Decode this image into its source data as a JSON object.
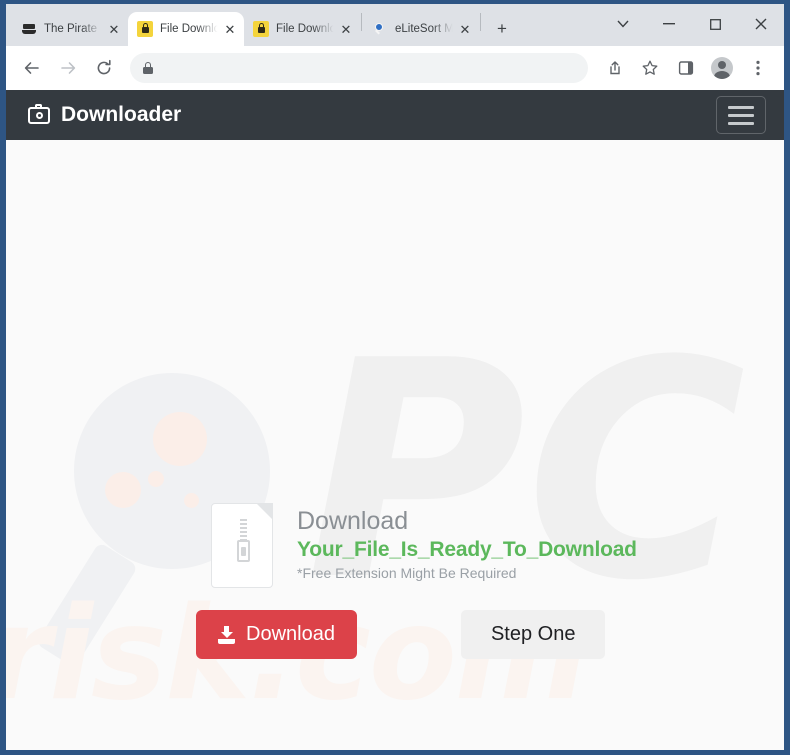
{
  "browser": {
    "tabs": [
      {
        "title": "The Pirate ",
        "favicon": "pirate-ship-icon",
        "active": false
      },
      {
        "title": "File Downlo",
        "favicon": "lock-icon",
        "active": true
      },
      {
        "title": "File Downlo",
        "favicon": "lock-icon",
        "active": false
      },
      {
        "title": "eLiteSort M",
        "favicon": "search-icon",
        "active": false
      }
    ],
    "new_tab_label": "+",
    "close_label": "✕",
    "window_controls": {
      "tab_search": "∨",
      "minimize": "−",
      "maximize": "□",
      "close": "✕"
    },
    "toolbar": {
      "back": "←",
      "forward": "→",
      "reload": "⟳",
      "share": "share-icon",
      "bookmark": "☆",
      "side_panel": "side-panel-icon",
      "profile": "profile-icon",
      "menu": "⋮"
    },
    "omnibox": {
      "url": "",
      "placeholder": "",
      "security_icon": "lock-icon"
    }
  },
  "page": {
    "navbar": {
      "brand": "Downloader",
      "brand_icon": "camera-icon",
      "toggler": "hamburger-menu-icon"
    },
    "download_card": {
      "file_icon": "zip-file-icon",
      "heading": "Download",
      "filename": "Your_File_Is_Ready_To_Download",
      "note": "*Free Extension Might Be Required"
    },
    "actions": {
      "download_label": "Download",
      "download_icon": "download-arrow-icon",
      "step_label": "Step One"
    },
    "watermark": {
      "text": "risk.com",
      "logo": "PC"
    },
    "colors": {
      "navbar": "#343a40",
      "download_button": "#dc4249",
      "filename_green": "#5cb85c",
      "step_button": "#f0f0f0",
      "window_frame": "#2e5584",
      "page_background": "#fafafa"
    }
  }
}
